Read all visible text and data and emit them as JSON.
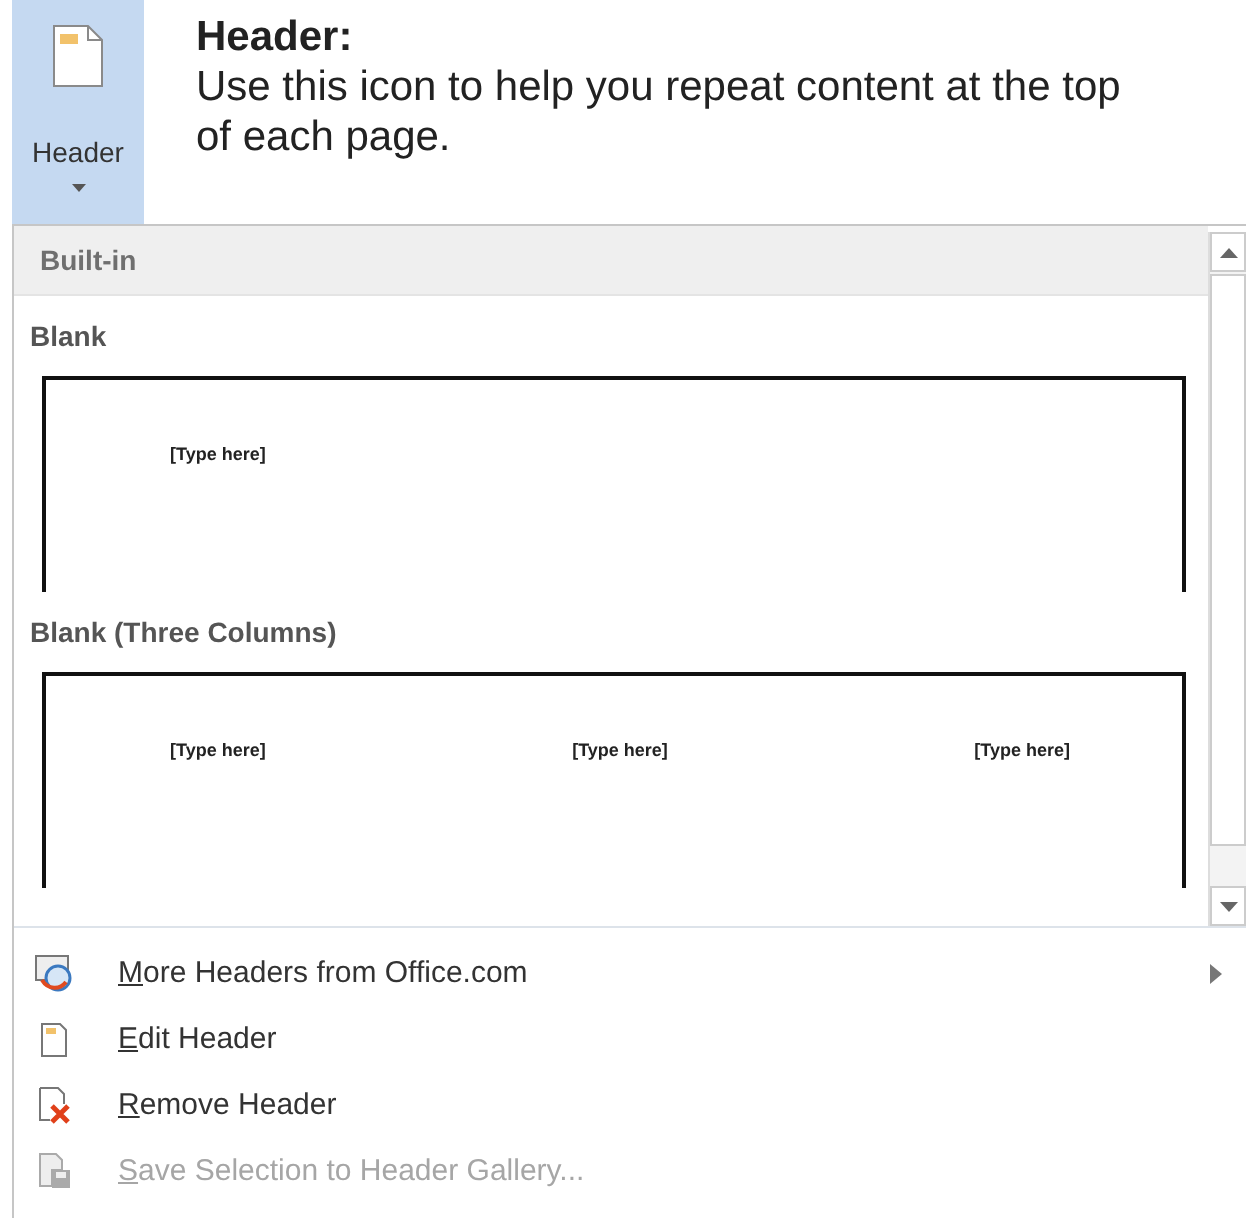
{
  "ribbon_button": {
    "label": "Header",
    "pressed": true
  },
  "callout": {
    "title": "Header:",
    "text": "Use this icon to help you repeat content at the top of each page."
  },
  "gallery": {
    "category": "Built-in",
    "items": [
      {
        "title": "Blank",
        "placeholders": [
          "[Type here]"
        ]
      },
      {
        "title": "Blank (Three Columns)",
        "placeholders": [
          "[Type here]",
          "[Type here]",
          "[Type here]"
        ]
      }
    ]
  },
  "menu": [
    {
      "label": "More Headers from Office.com",
      "kind": "globe",
      "disabled": false,
      "submenu": true
    },
    {
      "label": "Edit Header",
      "kind": "page",
      "disabled": false,
      "submenu": false
    },
    {
      "label": "Remove Header",
      "kind": "remove",
      "disabled": false,
      "submenu": false
    },
    {
      "label": "Save Selection to Header Gallery...",
      "kind": "save",
      "disabled": true,
      "submenu": false
    }
  ]
}
